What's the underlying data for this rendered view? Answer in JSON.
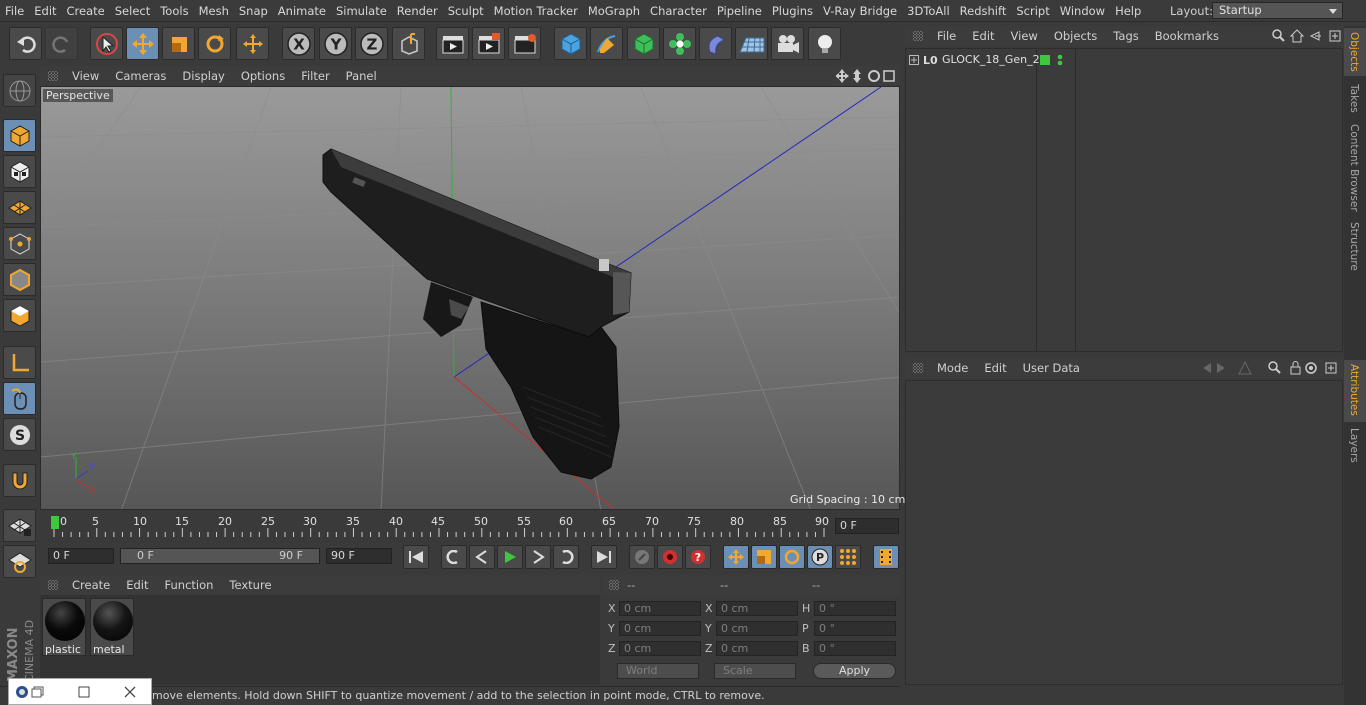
{
  "menubar": {
    "items": [
      "File",
      "Edit",
      "Create",
      "Select",
      "Tools",
      "Mesh",
      "Snap",
      "Animate",
      "Simulate",
      "Render",
      "Sculpt",
      "Motion Tracker",
      "MoGraph",
      "Character",
      "Pipeline",
      "Plugins",
      "V-Ray Bridge",
      "3DToAll",
      "Redshift",
      "Script",
      "Window",
      "Help"
    ],
    "layout_label": "Layout:",
    "layout_value": "Startup"
  },
  "viewport": {
    "menu": [
      "View",
      "Cameras",
      "Display",
      "Options",
      "Filter",
      "Panel"
    ],
    "camera_label": "Perspective",
    "grid_spacing": "Grid Spacing : 10 cm"
  },
  "timeline": {
    "ticks": [
      "0",
      "5",
      "10",
      "15",
      "20",
      "25",
      "30",
      "35",
      "40",
      "45",
      "50",
      "55",
      "60",
      "65",
      "70",
      "75",
      "80",
      "85",
      "90"
    ],
    "current_frame": "0 F",
    "start_field": "0 F",
    "range_start": "0 F",
    "range_end": "90 F",
    "end_field": "90 F"
  },
  "materials": {
    "menu": [
      "Create",
      "Edit",
      "Function",
      "Texture"
    ],
    "items": [
      {
        "name": "plastic"
      },
      {
        "name": "metal"
      }
    ]
  },
  "coords": {
    "headers": [
      "--",
      "--",
      "--"
    ],
    "rows": [
      {
        "l1": "X",
        "v1": "0 cm",
        "l2": "X",
        "v2": "0 cm",
        "l3": "H",
        "v3": "0 °"
      },
      {
        "l1": "Y",
        "v1": "0 cm",
        "l2": "Y",
        "v2": "0 cm",
        "l3": "P",
        "v3": "0 °"
      },
      {
        "l1": "Z",
        "v1": "0 cm",
        "l2": "Z",
        "v2": "0 cm",
        "l3": "B",
        "v3": "0 °"
      }
    ],
    "mode_world": "World",
    "mode_scale": "Scale",
    "apply": "Apply"
  },
  "status": "move elements. Hold down SHIFT to quantize movement / add to the selection in point mode, CTRL to remove.",
  "objects": {
    "menu": [
      "File",
      "Edit",
      "View",
      "Objects",
      "Tags",
      "Bookmarks"
    ],
    "items": [
      {
        "name": "GLOCK_18_Gen_2"
      }
    ]
  },
  "attributes": {
    "menu": [
      "Mode",
      "Edit",
      "User Data"
    ]
  },
  "side_tabs": [
    "Objects",
    "Takes",
    "Content Browser",
    "Structure",
    "Attributes",
    "Layers"
  ],
  "brand": {
    "line1": "MAXON",
    "line2": "CINEMA 4D"
  },
  "colors": {
    "accent": "#6b8fb5",
    "active_orange": "#e8a33a",
    "green": "#3ec83e"
  }
}
